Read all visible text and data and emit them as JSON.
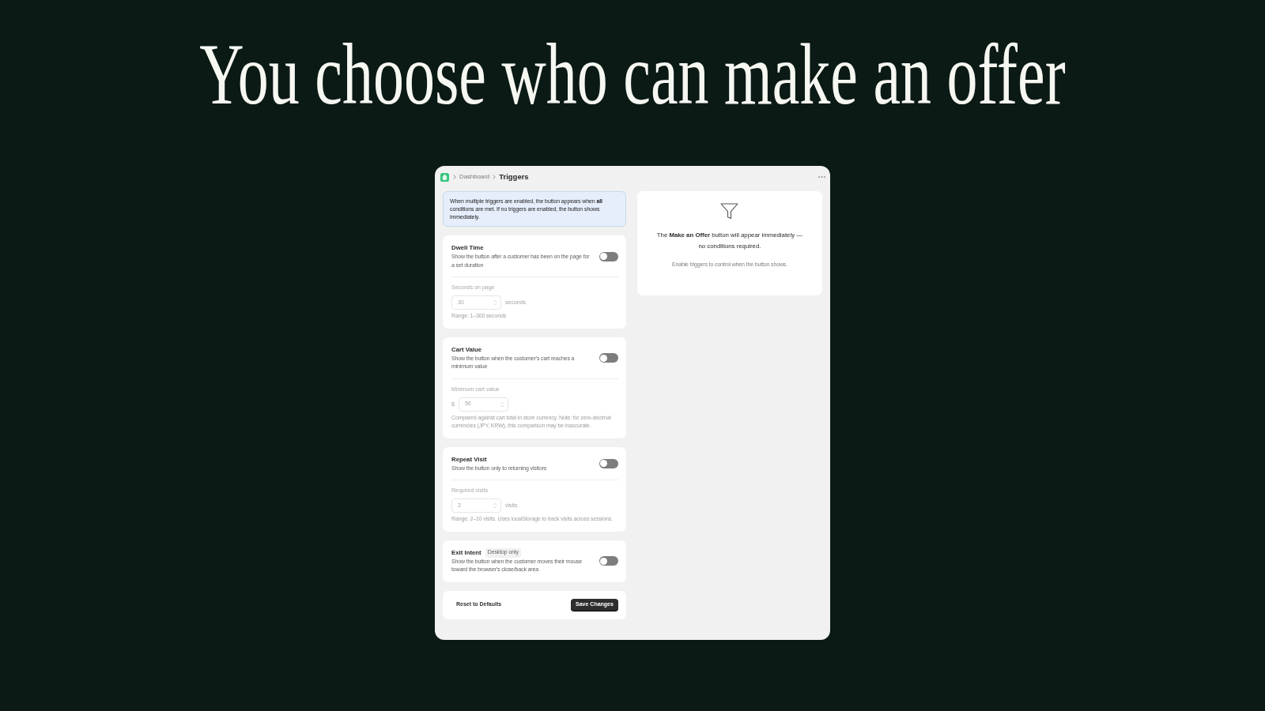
{
  "headline": "You choose who can make an offer",
  "window": {
    "breadcrumb": [
      {
        "label": "Dashboard",
        "current": false
      },
      {
        "label": "Triggers",
        "current": true
      }
    ],
    "info_banner": "When multiple triggers are enabled, the button appears when **all** conditions are met. If no triggers are enabled, the button shows immediately.",
    "triggers": [
      {
        "title": "Dwell Time",
        "description": "Show the button after a customer has been on the page for a set duration",
        "on": false,
        "field": {
          "label": "Seconds on page",
          "value": "30",
          "suffix": "seconds",
          "hint": "Range: 1–300 seconds"
        }
      },
      {
        "title": "Cart Value",
        "description": "Show the button when the customer's cart reaches a minimum value",
        "on": false,
        "field": {
          "label": "Minimum cart value",
          "prefix": "$",
          "value": "50",
          "hint": "Compared against cart total in store currency. Note: for zero-decimal currencies (JPY, KRW), this comparison may be inaccurate."
        }
      },
      {
        "title": "Repeat Visit",
        "description": "Show the button only to returning visitors",
        "on": false,
        "field": {
          "label": "Required visits",
          "value": "2",
          "suffix": "visits",
          "hint": "Range: 2–10 visits. Uses localStorage to track visits across sessions."
        }
      },
      {
        "title": "Exit Intent",
        "badge": "Desktop only",
        "description": "Show the button when the customer moves their mouse toward the browser's close/back area",
        "on": false
      }
    ],
    "actions": {
      "reset": "Reset to Defaults",
      "save": "Save Changes"
    },
    "preview": {
      "message": "The **Make an Offer** button will appear immediately — no conditions required.",
      "note": "Enable triggers to control when the button shows."
    }
  }
}
